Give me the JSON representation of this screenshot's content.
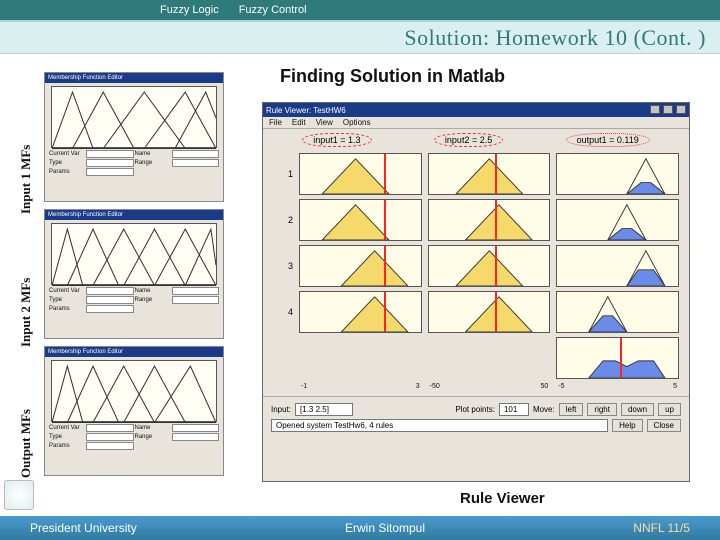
{
  "nav": {
    "item1": "Fuzzy Logic",
    "item2": "Fuzzy Control"
  },
  "title": "Solution: Homework 10 (Cont. )",
  "labels": {
    "input1": "Input 1 MFs",
    "input2": "Input 2 MFs",
    "output": "Output MFs"
  },
  "headings": {
    "big": "Finding Solution in Matlab",
    "rv": "Rule Viewer"
  },
  "footer": {
    "left": "President University",
    "center": "Erwin Sitompul",
    "right": "NNFL 11/5"
  },
  "mf_window": {
    "title": "Membership Function Editor",
    "controls": {
      "c1": "Current Var",
      "c2": "Name",
      "c3": "Type",
      "c4": "Range",
      "c5": "Params"
    }
  },
  "rule_viewer": {
    "title": "Rule Viewer: TestHW6",
    "menu": {
      "m1": "File",
      "m2": "Edit",
      "m3": "View",
      "m4": "Options"
    },
    "headers": {
      "h1": "input1 = 1.3",
      "h2": "input2 = 2.5",
      "h3": "output1 = 0.119"
    },
    "rows": {
      "r1": "1",
      "r2": "2",
      "r3": "3",
      "r4": "4"
    },
    "axis": {
      "c1a": "-1",
      "c1b": "3",
      "c2a": "-50",
      "c2b": "50",
      "c3a": "-5",
      "c3b": "5"
    },
    "controls": {
      "input_lbl": "Input:",
      "input_val": "[1.3 2.5]",
      "plot_lbl": "Plot points:",
      "plot_val": "101",
      "move_lbl": "Move:",
      "left": "left",
      "right": "right",
      "down": "down",
      "up": "up",
      "status": "Opened system TestHw6, 4 rules",
      "help": "Help",
      "close": "Close"
    }
  }
}
